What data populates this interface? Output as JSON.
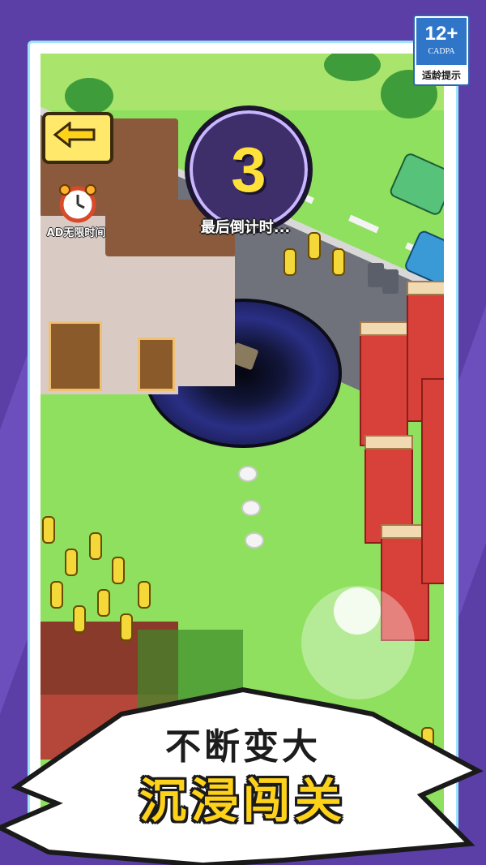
{
  "age_rating": {
    "label": "12+",
    "org": "CADPA",
    "tip": "适龄提示",
    "color": "#2f76c8"
  },
  "hud": {
    "back_button_icon": "back-arrow-icon",
    "countdown": {
      "value": "3",
      "label": "最后倒计时..."
    },
    "clock_item": {
      "icon": "alarm-clock-icon",
      "label": "AD无限时间"
    },
    "joystick_icon": "virtual-joystick"
  },
  "promo_banner": {
    "line1": "不断变大",
    "line2": "沉浸闯关",
    "highlight_color": "#ffd21a"
  },
  "colors": {
    "background": "#5b3fa6",
    "frame_border": "#9be3ff",
    "grass": "#8ee05e",
    "countdown_digit": "#ffe13a"
  }
}
